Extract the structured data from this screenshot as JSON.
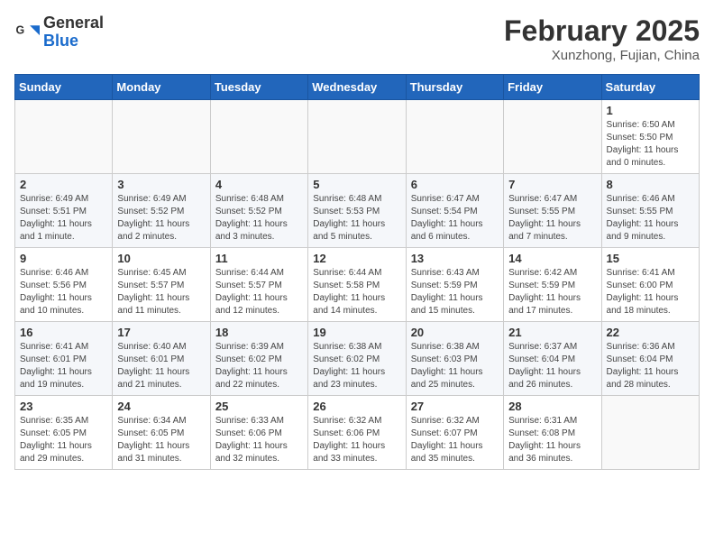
{
  "logo": {
    "general": "General",
    "blue": "Blue"
  },
  "header": {
    "month": "February 2025",
    "location": "Xunzhong, Fujian, China"
  },
  "weekdays": [
    "Sunday",
    "Monday",
    "Tuesday",
    "Wednesday",
    "Thursday",
    "Friday",
    "Saturday"
  ],
  "weeks": [
    [
      {
        "day": "",
        "info": ""
      },
      {
        "day": "",
        "info": ""
      },
      {
        "day": "",
        "info": ""
      },
      {
        "day": "",
        "info": ""
      },
      {
        "day": "",
        "info": ""
      },
      {
        "day": "",
        "info": ""
      },
      {
        "day": "1",
        "info": "Sunrise: 6:50 AM\nSunset: 5:50 PM\nDaylight: 11 hours and 0 minutes."
      }
    ],
    [
      {
        "day": "2",
        "info": "Sunrise: 6:49 AM\nSunset: 5:51 PM\nDaylight: 11 hours and 1 minute."
      },
      {
        "day": "3",
        "info": "Sunrise: 6:49 AM\nSunset: 5:52 PM\nDaylight: 11 hours and 2 minutes."
      },
      {
        "day": "4",
        "info": "Sunrise: 6:48 AM\nSunset: 5:52 PM\nDaylight: 11 hours and 3 minutes."
      },
      {
        "day": "5",
        "info": "Sunrise: 6:48 AM\nSunset: 5:53 PM\nDaylight: 11 hours and 5 minutes."
      },
      {
        "day": "6",
        "info": "Sunrise: 6:47 AM\nSunset: 5:54 PM\nDaylight: 11 hours and 6 minutes."
      },
      {
        "day": "7",
        "info": "Sunrise: 6:47 AM\nSunset: 5:55 PM\nDaylight: 11 hours and 7 minutes."
      },
      {
        "day": "8",
        "info": "Sunrise: 6:46 AM\nSunset: 5:55 PM\nDaylight: 11 hours and 9 minutes."
      }
    ],
    [
      {
        "day": "9",
        "info": "Sunrise: 6:46 AM\nSunset: 5:56 PM\nDaylight: 11 hours and 10 minutes."
      },
      {
        "day": "10",
        "info": "Sunrise: 6:45 AM\nSunset: 5:57 PM\nDaylight: 11 hours and 11 minutes."
      },
      {
        "day": "11",
        "info": "Sunrise: 6:44 AM\nSunset: 5:57 PM\nDaylight: 11 hours and 12 minutes."
      },
      {
        "day": "12",
        "info": "Sunrise: 6:44 AM\nSunset: 5:58 PM\nDaylight: 11 hours and 14 minutes."
      },
      {
        "day": "13",
        "info": "Sunrise: 6:43 AM\nSunset: 5:59 PM\nDaylight: 11 hours and 15 minutes."
      },
      {
        "day": "14",
        "info": "Sunrise: 6:42 AM\nSunset: 5:59 PM\nDaylight: 11 hours and 17 minutes."
      },
      {
        "day": "15",
        "info": "Sunrise: 6:41 AM\nSunset: 6:00 PM\nDaylight: 11 hours and 18 minutes."
      }
    ],
    [
      {
        "day": "16",
        "info": "Sunrise: 6:41 AM\nSunset: 6:01 PM\nDaylight: 11 hours and 19 minutes."
      },
      {
        "day": "17",
        "info": "Sunrise: 6:40 AM\nSunset: 6:01 PM\nDaylight: 11 hours and 21 minutes."
      },
      {
        "day": "18",
        "info": "Sunrise: 6:39 AM\nSunset: 6:02 PM\nDaylight: 11 hours and 22 minutes."
      },
      {
        "day": "19",
        "info": "Sunrise: 6:38 AM\nSunset: 6:02 PM\nDaylight: 11 hours and 23 minutes."
      },
      {
        "day": "20",
        "info": "Sunrise: 6:38 AM\nSunset: 6:03 PM\nDaylight: 11 hours and 25 minutes."
      },
      {
        "day": "21",
        "info": "Sunrise: 6:37 AM\nSunset: 6:04 PM\nDaylight: 11 hours and 26 minutes."
      },
      {
        "day": "22",
        "info": "Sunrise: 6:36 AM\nSunset: 6:04 PM\nDaylight: 11 hours and 28 minutes."
      }
    ],
    [
      {
        "day": "23",
        "info": "Sunrise: 6:35 AM\nSunset: 6:05 PM\nDaylight: 11 hours and 29 minutes."
      },
      {
        "day": "24",
        "info": "Sunrise: 6:34 AM\nSunset: 6:05 PM\nDaylight: 11 hours and 31 minutes."
      },
      {
        "day": "25",
        "info": "Sunrise: 6:33 AM\nSunset: 6:06 PM\nDaylight: 11 hours and 32 minutes."
      },
      {
        "day": "26",
        "info": "Sunrise: 6:32 AM\nSunset: 6:06 PM\nDaylight: 11 hours and 33 minutes."
      },
      {
        "day": "27",
        "info": "Sunrise: 6:32 AM\nSunset: 6:07 PM\nDaylight: 11 hours and 35 minutes."
      },
      {
        "day": "28",
        "info": "Sunrise: 6:31 AM\nSunset: 6:08 PM\nDaylight: 11 hours and 36 minutes."
      },
      {
        "day": "",
        "info": ""
      }
    ]
  ]
}
